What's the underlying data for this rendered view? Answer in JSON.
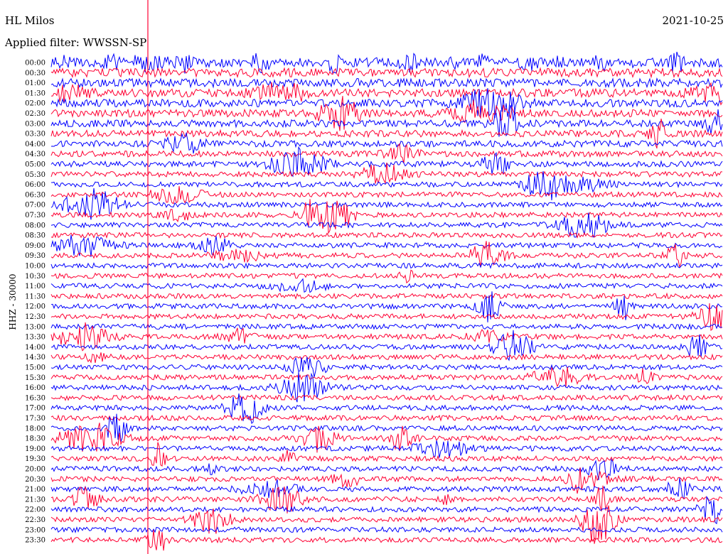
{
  "header": {
    "station": "HL Milos",
    "filter_text": "Applied filter: WWSSN-SP",
    "date": "2021-10-25"
  },
  "chart_data": {
    "type": "helicorder",
    "title": "HL Milos",
    "subtitle": "Applied filter: WWSSN-SP",
    "date": "2021-10-25",
    "ylabel": "HHZ - 30000",
    "line_interval_minutes": 30,
    "rows": [
      "00:00",
      "00:30",
      "01:00",
      "01:30",
      "02:00",
      "02:30",
      "03:00",
      "03:30",
      "04:00",
      "04:30",
      "05:00",
      "05:30",
      "06:00",
      "06:30",
      "07:00",
      "07:30",
      "08:00",
      "08:30",
      "09:00",
      "09:30",
      "10:00",
      "10:30",
      "11:00",
      "11:30",
      "12:00",
      "12:30",
      "13:00",
      "13:30",
      "14:00",
      "14:30",
      "15:00",
      "15:30",
      "16:00",
      "16:30",
      "17:00",
      "17:30",
      "18:00",
      "18:30",
      "19:00",
      "19:30",
      "20:00",
      "20:30",
      "21:00",
      "21:30",
      "22:00",
      "22:30",
      "23:00",
      "23:30"
    ],
    "colors": [
      "#0000ff",
      "#ff0033"
    ],
    "grid": false,
    "legend": "none"
  }
}
